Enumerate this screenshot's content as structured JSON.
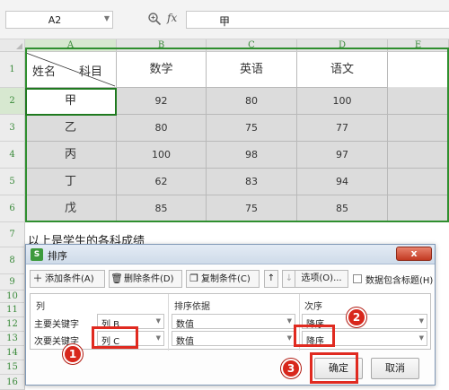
{
  "formula_bar": {
    "cell_ref": "A2",
    "fx_label": "fx",
    "formula_value": "甲"
  },
  "columns": [
    "A",
    "B",
    "C",
    "D",
    "E"
  ],
  "rows": [
    "1",
    "2",
    "3",
    "4",
    "5",
    "6",
    "7",
    "8",
    "9",
    "10",
    "11",
    "12",
    "13",
    "14",
    "15",
    "16"
  ],
  "table": {
    "corner_left": "姓名",
    "corner_right": "科目",
    "headers": [
      "数学",
      "英语",
      "语文"
    ],
    "rows": [
      [
        "甲",
        "92",
        "80",
        "100"
      ],
      [
        "乙",
        "80",
        "75",
        "77"
      ],
      [
        "丙",
        "100",
        "98",
        "97"
      ],
      [
        "丁",
        "62",
        "83",
        "94"
      ],
      [
        "戊",
        "85",
        "75",
        "85"
      ]
    ]
  },
  "note": "以上是学生的各科成绩",
  "dialog": {
    "icon": "S",
    "title": "排序",
    "close": "x",
    "toolbar": {
      "add": "添加条件(A)",
      "delete": "删除条件(D)",
      "copy": "复制条件(C)",
      "options": "选项(O)...",
      "header_checkbox": "数据包含标题(H)"
    },
    "grid": {
      "col_column": "列",
      "col_basis": "排序依据",
      "col_order": "次序",
      "rows": [
        {
          "label": "主要关键字",
          "column": "列 B",
          "basis": "数值",
          "order": "降序"
        },
        {
          "label": "次要关键字",
          "column": "列 C",
          "basis": "数值",
          "order": "降序"
        }
      ]
    },
    "ok": "确定",
    "cancel": "取消"
  },
  "annotations": [
    "1",
    "2",
    "3"
  ],
  "colors": {
    "selection_green": "#2f8f2f",
    "highlight_red": "#e02a20",
    "cell_gray": "#dcdcdc"
  }
}
